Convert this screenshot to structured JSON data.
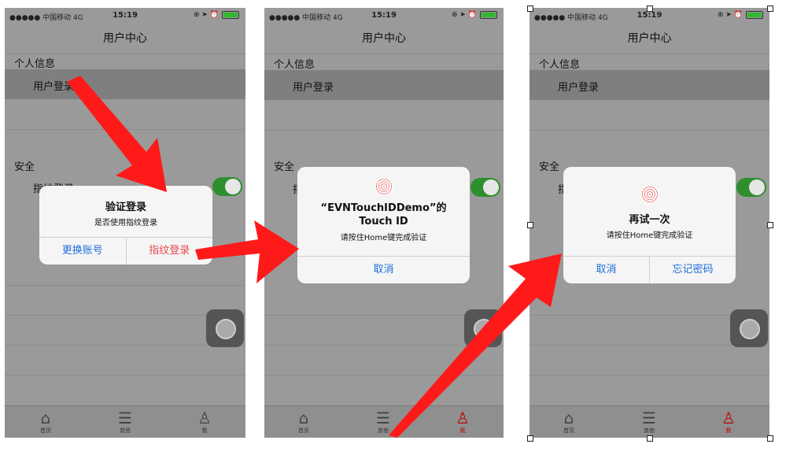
{
  "status": {
    "carrier": "●●●●● 中国移动  4G",
    "time": "15:19",
    "icons": "⊕ ➤ ⏰"
  },
  "nav": {
    "title": "用户中心"
  },
  "sections": {
    "personal": "个人信息",
    "security": "安全"
  },
  "rows": {
    "user_login": "用户登录",
    "fingerprint_login": "指纹登录"
  },
  "tabs": {
    "home": "首页",
    "other": "其他",
    "me": "我"
  },
  "dialog1": {
    "title": "验证登录",
    "message": "是否使用指纹登录",
    "btn_left": "更换账号",
    "btn_right": "指纹登录",
    "btn_right_color": "#e84a4a"
  },
  "dialog2": {
    "title": "“EVNTouchIDDemo”的 Touch ID",
    "message": "请按住Home键完成验证",
    "btn_cancel": "取消"
  },
  "dialog3": {
    "title": "再试一次",
    "message": "请按住Home键完成验证",
    "btn_left": "取消",
    "btn_right": "忘记密码"
  },
  "colors": {
    "arrow": "#ff1a1a",
    "link": "#1e6fd9",
    "toggle": "#2d8f2d",
    "tab_active": "#c00000"
  }
}
